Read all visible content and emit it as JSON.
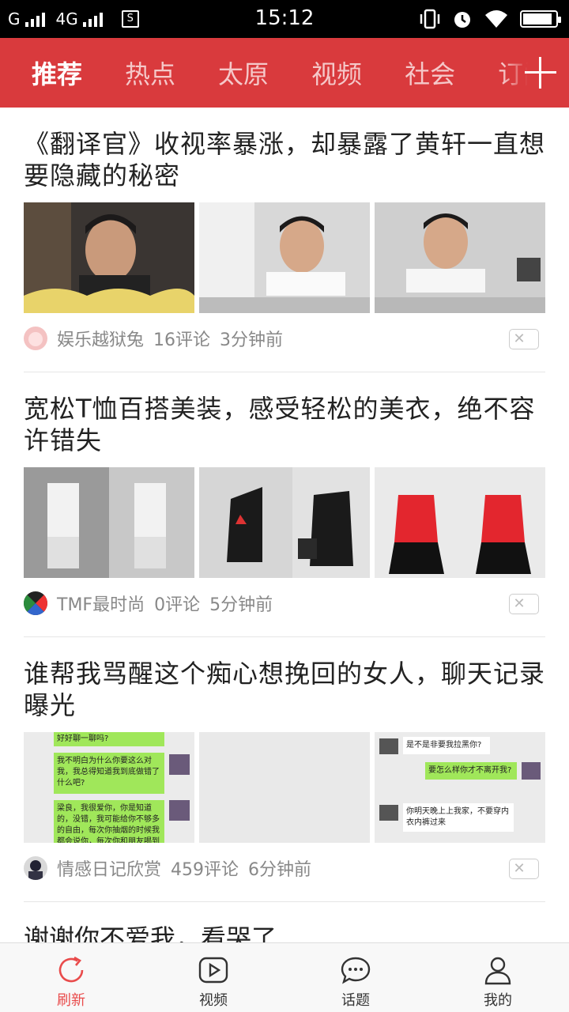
{
  "status_bar": {
    "carrier1": "G",
    "carrier2": "4G",
    "time": "15:12",
    "battery_level": 0.9
  },
  "tabs": [
    {
      "label": "推荐",
      "active": true
    },
    {
      "label": "热点"
    },
    {
      "label": "太原"
    },
    {
      "label": "视频"
    },
    {
      "label": "社会"
    },
    {
      "label": "订阅"
    }
  ],
  "feed": {
    "articles": [
      {
        "title": "《翻译官》收视率暴涨，却暴露了黄轩一直想要隐藏的秘密",
        "source": "娱乐越狱兔",
        "comments": "16评论",
        "time": "3分钟前",
        "dismiss_icon": "close-icon"
      },
      {
        "title": "宽松T恤百搭美装，感受轻松的美衣，绝不容许错失",
        "source": "TMF最时尚",
        "comments": "0评论",
        "time": "5分钟前",
        "dismiss_icon": "close-icon"
      },
      {
        "title": "谁帮我骂醒这个痴心想挽回的女人，聊天记录曝光",
        "source": "情感日记欣赏",
        "comments": "459评论",
        "time": "6分钟前",
        "dismiss_icon": "close-icon",
        "chat_lines": {
          "a1": "好好聊一聊吗?",
          "a2": "我不明白为什么你要这么对我，我总得知道我到底做错了什么吧?",
          "a3": "梁良，我很爱你，你是知道的，没错，我可能给你不够多的自由，每次你抽烟的时候我都会说你，每次你和朋友喝到很",
          "b1": "是不是非要我拉黑你?",
          "b2": "要怎么样你才不离开我?",
          "b3": "你明天晚上上我家，不要穿内衣内裤过来"
        }
      }
    ],
    "partial_title": "谢谢你不爱我，看哭了"
  },
  "bottom_nav": [
    {
      "label": "刷新",
      "icon": "refresh-icon",
      "active": true
    },
    {
      "label": "视频",
      "icon": "play-icon"
    },
    {
      "label": "话题",
      "icon": "chat-bubble-icon"
    },
    {
      "label": "我的",
      "icon": "user-icon"
    }
  ],
  "colors": {
    "accent": "#d93a3d",
    "active_nav": "#e94b4b"
  }
}
